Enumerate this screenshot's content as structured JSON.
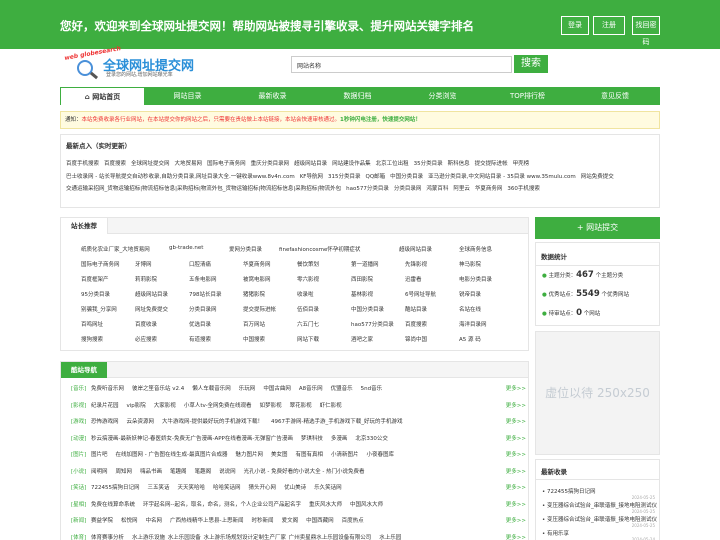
{
  "header": {
    "welcome": "您好，欢迎来到全球网址提交网！帮助网站被搜寻引擎收录、提升网站关键字排名",
    "login": "登录",
    "register": "注册",
    "forgot_password": "找回密码"
  },
  "logo": {
    "red_text": "web globesearch",
    "title": "全球网址提交网",
    "subtitle": "登录您的网站,增加网站曝光率"
  },
  "search": {
    "label": "网站名称",
    "placeholder": "",
    "button": "搜索"
  },
  "nav": {
    "items": [
      "网站首页",
      "网站目录",
      "最新收录",
      "数据归档",
      "分类浏览",
      "TOP排行榜",
      "意见反馈"
    ]
  },
  "notice": {
    "prefix": "通知：",
    "text_red": "本站免费收录各行业网站，在本站提交你的网站之后，只需要在贵站做上本站链接，本站会快速审核通过。",
    "text_green": "1秒钟闪电注册，快速提交网站！"
  },
  "recent": {
    "title": "最新点入（实时更新）",
    "links": [
      "百度手机搜索",
      "百度搜索",
      "全球网址提交网",
      "大地贸易网",
      "国际电子商务网",
      "重庆分类目录网",
      "超级网站目录",
      "网站建设作品集",
      "北京工位出租",
      "35分类目录",
      "斯科信息",
      "提交提际进帐",
      "甲壳榜",
      "巴士收录网 - 站长导航提交自动秒收录,自助分类目录,网址目录大全.一键收录www.8v4n.com",
      "KF导航网",
      "315分类目录",
      "QQ邮箱",
      "中国分类目录",
      "亚马逊分类目录,中文网站目录 - 35目录 www.35mulu.com",
      "网站免费提交",
      "交通运输采招网_货物运输招标|物流招标信息|采购招标|物流外包_货物运输招标|物流招标信息|采购招标|物流外包",
      "hao577分类目录",
      "分类目录网",
      "鸿蒙百科",
      "阿里云",
      "华夏商务网",
      "360手机搜索"
    ]
  },
  "recommend": {
    "title": "站长推荐",
    "items": [
      [
        "纸质化农业厂家_大地贸易网",
        "gb-trade.net",
        "爱网分类目录",
        "finefashioncosme怀孕初期症状",
        "超级网站目录",
        "全球商务信息"
      ],
      [
        "国际电子商务网",
        "牙博网",
        "口腔清痛",
        "华夏商务网",
        "餐饮策划",
        "第一道播网",
        "先锋影视",
        "神马影院"
      ],
      [
        "百度框架产",
        "莉莉影院",
        "五条电影网",
        "被窝电影网",
        "零六影视",
        "西田影院",
        "迅雷看",
        "电影分类目录"
      ],
      [
        "95分类目录",
        "超级网站目录",
        "798站长目录",
        "猪猪影院",
        "收录啦",
        "基林影视",
        "6号网址导航",
        "锐帝目录"
      ],
      [
        "别骗我_分享网",
        "网址免费提交",
        "分类目录网",
        "提交提际进帐",
        "伍佰目录",
        "中国分类目录",
        "酷站目录",
        "名站在线"
      ],
      [
        "百鸣网址",
        "百度收录",
        "优选目录",
        "百万网站",
        "六五门七",
        "hao577分类目录",
        "百度搜索",
        "海洋目录网"
      ],
      [
        "搜狗搜索",
        "必应搜索",
        "有道搜索",
        "中国搜索",
        "网站下载",
        "酒吧之家",
        "锦尚中国",
        "A5 源 码"
      ]
    ]
  },
  "categories": {
    "title": "酷站导航",
    "more": "更多>>",
    "rows": [
      {
        "cat": "[音乐]",
        "items": [
          "免费听音乐网",
          "彼岸之笙音乐站 v2.4",
          "懒人车载音乐网",
          "乐玩网",
          "中国古曲网",
          "A8音乐网",
          "优盟音乐",
          "5nd音乐"
        ]
      },
      {
        "cat": "[影视]",
        "items": [
          "纪录片花园",
          "vip影院",
          "大家影视",
          "小草人tv-全网免费在线观看",
          "如梦影视",
          "翠花影视",
          "虾仁影视"
        ]
      },
      {
        "cat": "[游戏]",
        "items": [
          "恐怖游戏网",
          "云朵资源网",
          "大牛游戏网-提供最好玩的手机游戏下载！",
          "4967手游网-精选手游_手机游戏下载_好玩的手机游戏"
        ]
      },
      {
        "cat": "[动漫]",
        "items": [
          "秒云搞漫画-最新妖神记-春医娇女-免费无广告漫画-APP在线看漫画-无弹窗广告漫画",
          "梦琪科技",
          "多漫画",
          "北京330公交"
        ]
      },
      {
        "cat": "[图片]",
        "items": [
          "图片吧",
          "在线加图网 - 广告图在线生成-最真图片合成器",
          "魅力图片网",
          "美女图",
          "有图有真相",
          "小清新图片",
          "小夜春图库"
        ]
      },
      {
        "cat": "[小说]",
        "items": [
          "阅明网",
          "周知网",
          "嗨品书画",
          "笔趣阁",
          "笔趣阁",
          "说说网",
          "光孔小说 - 免费好看的小说大全 - 热门小说免费看"
        ]
      },
      {
        "cat": "[笑话]",
        "items": [
          "722455搞狗日记网",
          "三五笑话",
          "天天笑哈哈",
          "哈哈笑话网",
          "猜头开心网",
          "优山美诗",
          "乐久笑话网"
        ]
      },
      {
        "cat": "[星相]",
        "items": [
          "免费在线算命系统",
          "环宇起名网--起名，取名，命名，测名，个人企业公司产品起名字",
          "重庆风水大师",
          "中国风水大师"
        ]
      },
      {
        "cat": "[新闻]",
        "items": [
          "赛益学院",
          "松悦网",
          "中名网",
          "广西热线精华上思县-上思新闻",
          "时秒新闻",
          "爱文阁",
          "中国西藏网",
          "百度热点"
        ]
      },
      {
        "cat": "[体育]",
        "items": [
          "体育赛事分析",
          "水上游乐设施_水上乐园设备_水上游乐场规划设计定制生产厂家_广州卖星鼎水上乐园设备有限公司",
          "水上乐园"
        ]
      }
    ]
  },
  "sidebar": {
    "submit_button": "+ 网站提交",
    "stats": {
      "title": "数据统计",
      "lines": [
        {
          "prefix": "主题分类：",
          "value": "467",
          "suffix": "个主题分类"
        },
        {
          "prefix": "优秀站点：",
          "value": "5549",
          "suffix": "个优秀网站"
        },
        {
          "prefix": "待审站点：",
          "value": "0",
          "suffix": "个网站"
        }
      ]
    },
    "ad_text": "虚位以待 250x250",
    "latest": {
      "title": "最新收录",
      "items": [
        {
          "name": "722455搞狗日记网",
          "date": "2024-05-25"
        },
        {
          "name": "变压器综合试验台_串联谐振_接地电阻测试仪",
          "date": "2024-05-25"
        },
        {
          "name": "变压器综合试验台_串联谐振_接地电阻测试仪",
          "date": "2024-05-25"
        },
        {
          "name": "有用乐享",
          "date": "2024-05-24"
        }
      ]
    }
  },
  "colors": {
    "primary": "#3eae40",
    "accent_blue": "#2a8fd8",
    "notice_red": "#e33"
  }
}
